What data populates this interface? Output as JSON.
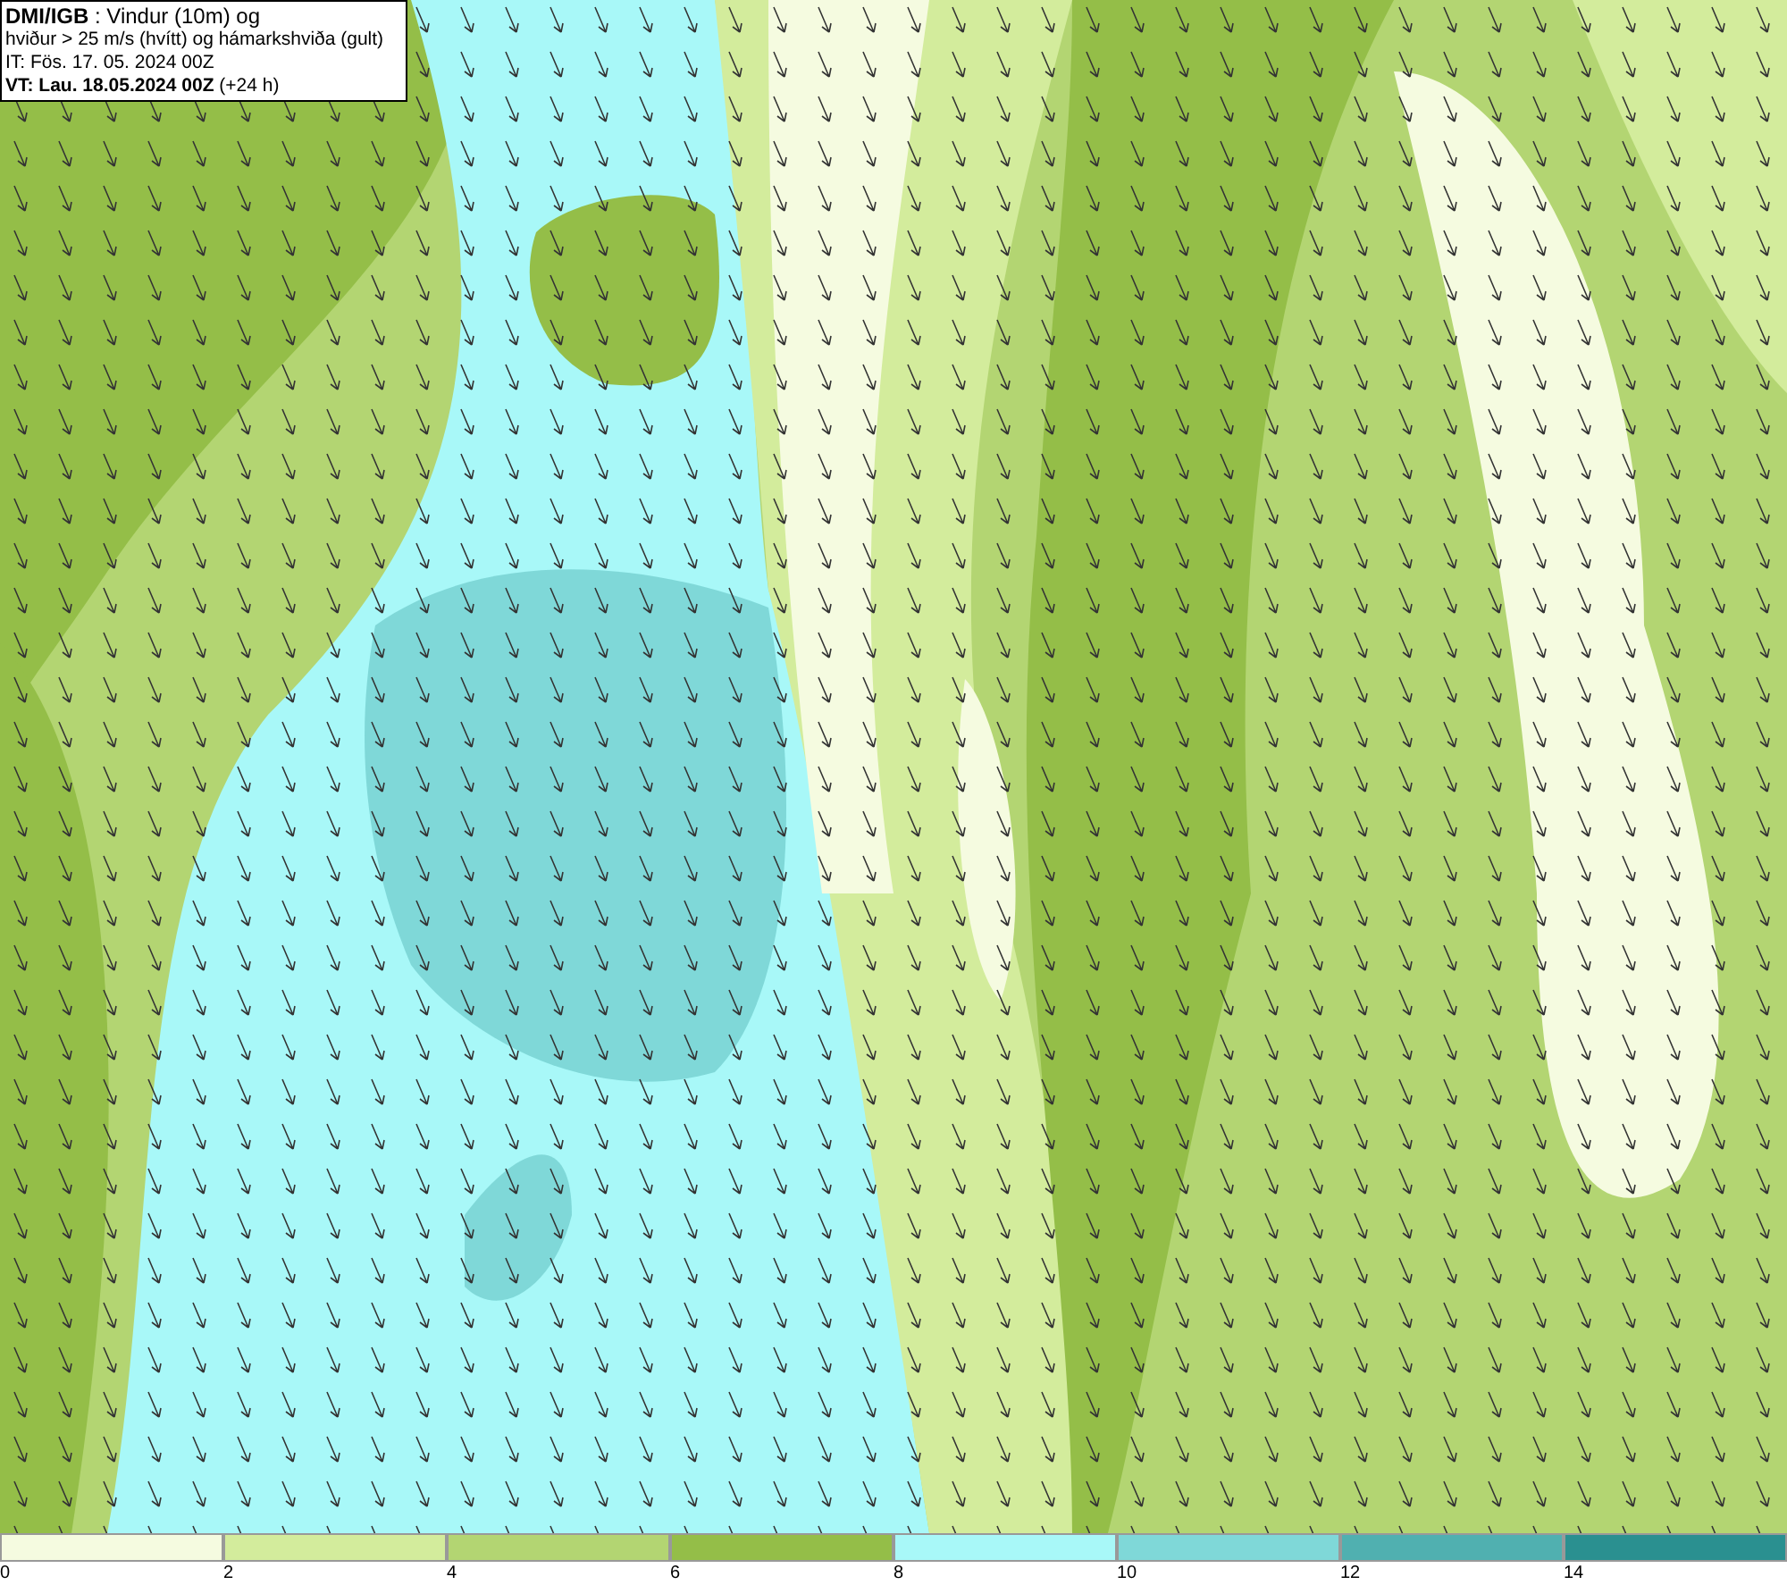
{
  "info_box": {
    "lines": [
      "**DMI/IGB** : Vindur (10m) og",
      "hviður > 25 m/s (hvítt) og hámarkshviða (gult)",
      "IT: Fös. 17. 05. 2024 00Z",
      "**VT: Lau. 18.05.2024 00Z** (+24 h)"
    ]
  },
  "legend": [
    {
      "label": "0",
      "color": "#f5fbe0"
    },
    {
      "label": "2",
      "color": "#d3ec9c"
    },
    {
      "label": "4",
      "color": "#b3d572"
    },
    {
      "label": "6",
      "color": "#94be48"
    },
    {
      "label": "8",
      "color": "#a8f8f8"
    },
    {
      "label": "10",
      "color": "#7fd8d8"
    },
    {
      "label": "12",
      "color": "#50b0b0"
    },
    {
      "label": "14",
      "color": "#2a9090"
    }
  ]
}
